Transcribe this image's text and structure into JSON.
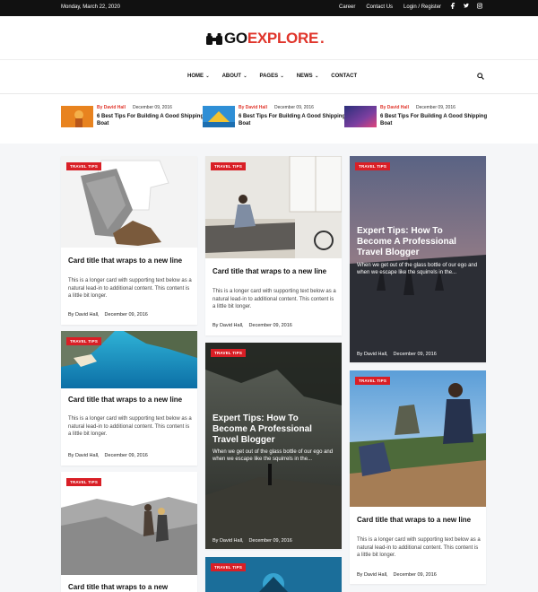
{
  "topbar": {
    "date": "Monday, March 22, 2020",
    "links": [
      "Career",
      "Contact Us",
      "Login / Register"
    ],
    "social": [
      "facebook-icon",
      "twitter-icon",
      "instagram-icon"
    ]
  },
  "logo": {
    "part1": "GO",
    "part2": "EXPLORE",
    "dot": "."
  },
  "nav": {
    "items": [
      {
        "label": "HOME",
        "dropdown": true
      },
      {
        "label": "ABOUT",
        "dropdown": true
      },
      {
        "label": "PAGES",
        "dropdown": true
      },
      {
        "label": "NEWS",
        "dropdown": true
      },
      {
        "label": "CONTACT",
        "dropdown": false
      }
    ],
    "search_icon": "search-icon"
  },
  "trending": [
    {
      "author": "By David Hall",
      "date": "December 09, 2016",
      "title": "6 Best Tips For Building A Good Shipping Boat"
    },
    {
      "author": "By David Hall",
      "date": "December 09, 2016",
      "title": "6 Best Tips For Building A Good Shipping Boat"
    },
    {
      "author": "By David Hall",
      "date": "December 09, 2016",
      "title": "6 Best Tips For Building A Good Shipping Boat"
    }
  ],
  "cards": {
    "c1": {
      "tag": "TRAVEL TIPS",
      "title": "Card title that wraps to a new line",
      "text": "This is a longer card with supporting text below as a natural lead-in to additional content. This content is a little bit longer.",
      "author": "By David Hall,",
      "date": "December 09, 2016"
    },
    "c2": {
      "tag": "TRAVEL TIPS",
      "title": "Card title that wraps to a new line",
      "text": "This is a longer card with supporting text below as a natural lead-in to additional content. This content is a little bit longer.",
      "author": "By David Hall,",
      "date": "December 09, 2016"
    },
    "c3": {
      "tag": "TRAVEL TIPS",
      "title": "Card title that wraps to a new",
      "author": "",
      "date": ""
    },
    "c4": {
      "tag": "TRAVEL TIPS",
      "title": "Card title that wraps to a new line",
      "text": "This is a longer card with supporting text below as a natural lead-in to additional content. This content is a little bit longer.",
      "author": "By David Hall,",
      "date": "December 09, 2016"
    },
    "c5": {
      "tag": "TRAVEL TIPS",
      "title": "Expert Tips: How To Become A Professional Travel Blogger",
      "text": "When we get out of the glass bottle of our ego and when we escape like the squirrels in the...",
      "author": "By David Hall,",
      "date": "December 09, 2016"
    },
    "c6": {
      "tag": "TRAVEL TIPS"
    },
    "c7": {
      "tag": "TRAVEL TIPS",
      "title": "Expert Tips: How To Become A Professional Travel Blogger",
      "text": "When we get out of the glass bottle of our ego and when we escape like the squirrels in the...",
      "author": "By David Hall,",
      "date": "December 09, 2016"
    },
    "c8": {
      "tag": "TRAVEL TIPS",
      "title": "Card title that wraps to a new line",
      "text": "This is a longer card with supporting text below as a natural lead-in to additional content. This content is a little bit longer.",
      "author": "By David Hall,",
      "date": "December 09, 2016"
    }
  },
  "colors": {
    "accent": "#e0352b",
    "tag": "#d91f26",
    "topbar": "#111111"
  }
}
